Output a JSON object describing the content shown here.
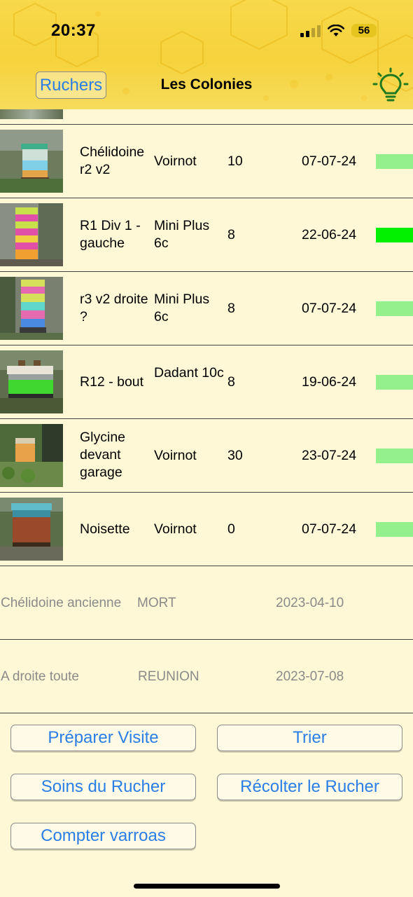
{
  "status": {
    "time": "20:37",
    "battery": "56"
  },
  "nav": {
    "back_label": "Ruchers",
    "title": "Les Colonies"
  },
  "colors": {
    "accent": "#2a7ee6",
    "bar_light": "#94f08d",
    "bar_bright": "#00f000"
  },
  "colonies": [
    {
      "name": "Chélidoine r2 v2",
      "type": "Voirnot",
      "count": "10",
      "date": "07-07-24",
      "bar": "light"
    },
    {
      "name": "R1 Div 1  - gauche",
      "type": "Mini Plus 6c",
      "count": "8",
      "date": "22-06-24",
      "bar": "bright"
    },
    {
      "name": "r3 v2 droite ?",
      "type": "Mini Plus 6c",
      "count": "8",
      "date": "07-07-24",
      "bar": "light"
    },
    {
      "name": "R12 - bout",
      "type": "Dadant 10c",
      "count": "8",
      "date": "19-06-24",
      "bar": "light"
    },
    {
      "name": "Glycine devant garage",
      "type": "Voirnot",
      "count": "30",
      "date": "23-07-24",
      "bar": "light"
    },
    {
      "name": "Noisette",
      "type": "Voirnot",
      "count": "0",
      "date": "07-07-24",
      "bar": "light"
    }
  ],
  "dead_colonies": [
    {
      "name": "Chélidoine ancienne",
      "status": "MORT",
      "date": "2023-04-10"
    },
    {
      "name": "A droite toute",
      "status": "REUNION",
      "date": "2023-07-08"
    }
  ],
  "buttons": {
    "prepare": "Préparer Visite",
    "sort": "Trier",
    "care": "Soins du Rucher",
    "harvest": "Récolter le Rucher",
    "varroa": "Compter varroas"
  }
}
